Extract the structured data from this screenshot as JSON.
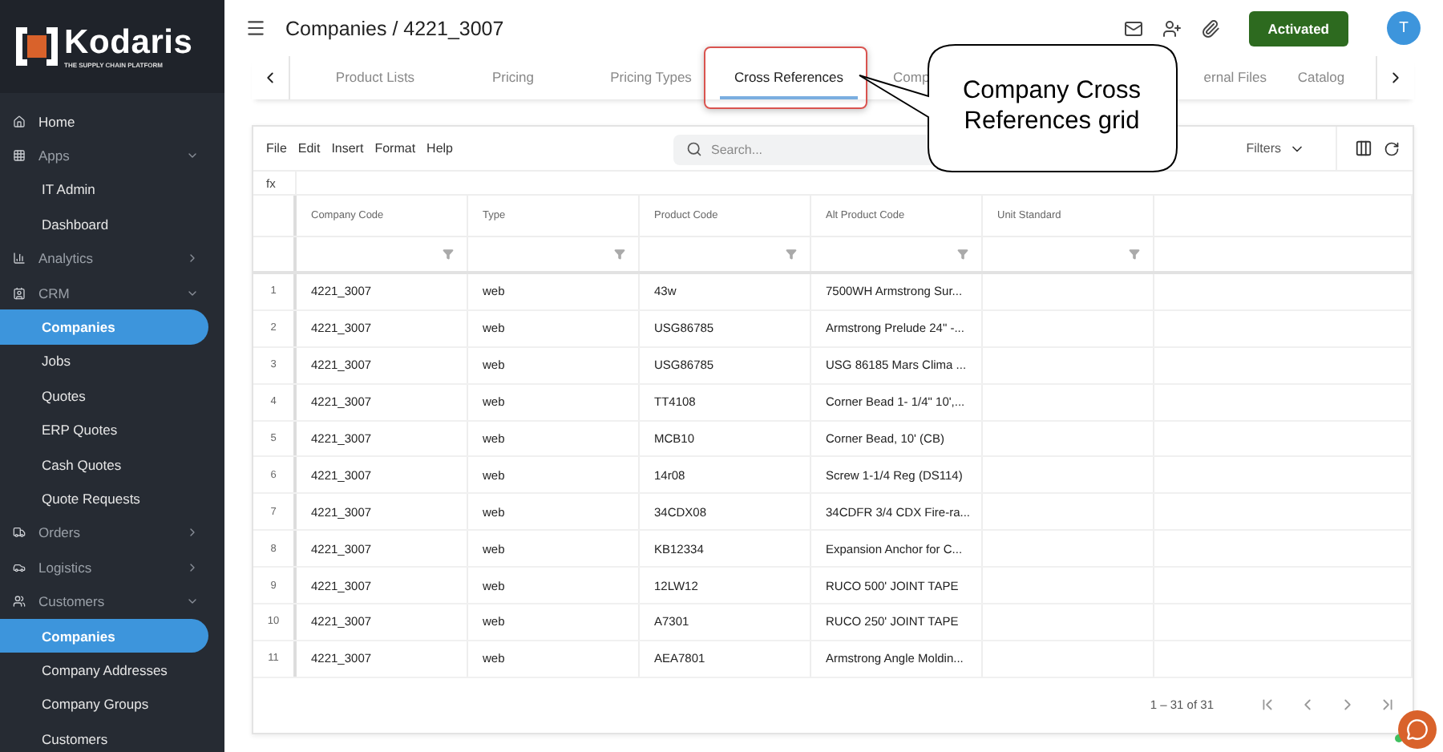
{
  "sidebar": {
    "logo": {
      "name": "Kodaris",
      "tagline": "THE SUPPLY CHAIN PLATFORM"
    },
    "items": [
      {
        "label": "Home",
        "kind": "link",
        "selected": false
      },
      {
        "label": "Apps",
        "kind": "group",
        "expanded": true,
        "selected": false,
        "children": [
          {
            "label": "IT Admin",
            "selected": false
          },
          {
            "label": "Dashboard",
            "selected": false
          }
        ]
      },
      {
        "label": "Analytics",
        "kind": "group",
        "expanded": false,
        "selected": false
      },
      {
        "label": "CRM",
        "kind": "group",
        "expanded": true,
        "selected": false,
        "children": [
          {
            "label": "Companies",
            "selected": true
          },
          {
            "label": "Jobs",
            "selected": false
          },
          {
            "label": "Quotes",
            "selected": false
          },
          {
            "label": "ERP Quotes",
            "selected": false
          },
          {
            "label": "Cash Quotes",
            "selected": false
          },
          {
            "label": "Quote Requests",
            "selected": false
          }
        ]
      },
      {
        "label": "Orders",
        "kind": "group",
        "expanded": false,
        "selected": false
      },
      {
        "label": "Logistics",
        "kind": "group",
        "expanded": false,
        "selected": false
      },
      {
        "label": "Customers",
        "kind": "group",
        "expanded": true,
        "selected": false,
        "children": [
          {
            "label": "Companies",
            "selected": true
          },
          {
            "label": "Company Addresses",
            "selected": false
          },
          {
            "label": "Company Groups",
            "selected": false
          },
          {
            "label": "Customers",
            "selected": false
          }
        ]
      }
    ]
  },
  "header": {
    "title": "Companies / 4221_3007",
    "status": "Activated",
    "avatar": "T"
  },
  "tabs": [
    {
      "label": "Product Lists",
      "selected": false
    },
    {
      "label": "Pricing",
      "selected": false
    },
    {
      "label": "Pricing Types",
      "selected": false
    },
    {
      "label": "Cross References",
      "selected": true
    },
    {
      "label": "Comp",
      "selected": false
    },
    {
      "label": "ernal Files",
      "selected": false
    },
    {
      "label": "Catalog",
      "selected": false
    }
  ],
  "callout": {
    "text": "Company Cross References grid"
  },
  "grid": {
    "menu": [
      "File",
      "Edit",
      "Insert",
      "Format",
      "Help"
    ],
    "search": {
      "placeholder": "Search..."
    },
    "filters": "Filters",
    "formula_label": "fx",
    "columns": [
      "Company Code",
      "Type",
      "Product Code",
      "Alt Product Code",
      "Unit Standard"
    ],
    "rows": [
      {
        "number": "1",
        "cells": [
          "4221_3007",
          "web",
          "43w",
          "7500WH Armstrong Sur..."
        ]
      },
      {
        "number": "2",
        "cells": [
          "4221_3007",
          "web",
          "USG86785",
          "Armstrong Prelude 24\" -..."
        ]
      },
      {
        "number": "3",
        "cells": [
          "4221_3007",
          "web",
          "USG86785",
          "USG 86185 Mars Clima ..."
        ]
      },
      {
        "number": "4",
        "cells": [
          "4221_3007",
          "web",
          "TT4108",
          "Corner Bead 1- 1/4\" 10',..."
        ]
      },
      {
        "number": "5",
        "cells": [
          "4221_3007",
          "web",
          "MCB10",
          "Corner Bead, 10' (CB)"
        ]
      },
      {
        "number": "6",
        "cells": [
          "4221_3007",
          "web",
          "14r08",
          "Screw 1-1/4 Reg (DS114)"
        ]
      },
      {
        "number": "7",
        "cells": [
          "4221_3007",
          "web",
          "34CDX08",
          "34CDFR 3/4 CDX Fire-ra..."
        ]
      },
      {
        "number": "8",
        "cells": [
          "4221_3007",
          "web",
          "KB12334",
          "Expansion Anchor for C..."
        ]
      },
      {
        "number": "9",
        "cells": [
          "4221_3007",
          "web",
          "12LW12",
          "RUCO 500' JOINT TAPE"
        ]
      },
      {
        "number": "10",
        "cells": [
          "4221_3007",
          "web",
          "A7301",
          "RUCO 250' JOINT TAPE"
        ]
      },
      {
        "number": "11",
        "cells": [
          "4221_3007",
          "web",
          "AEA7801",
          "Armstrong Angle Moldin..."
        ]
      }
    ],
    "pagination": "1 – 31 of 31"
  }
}
